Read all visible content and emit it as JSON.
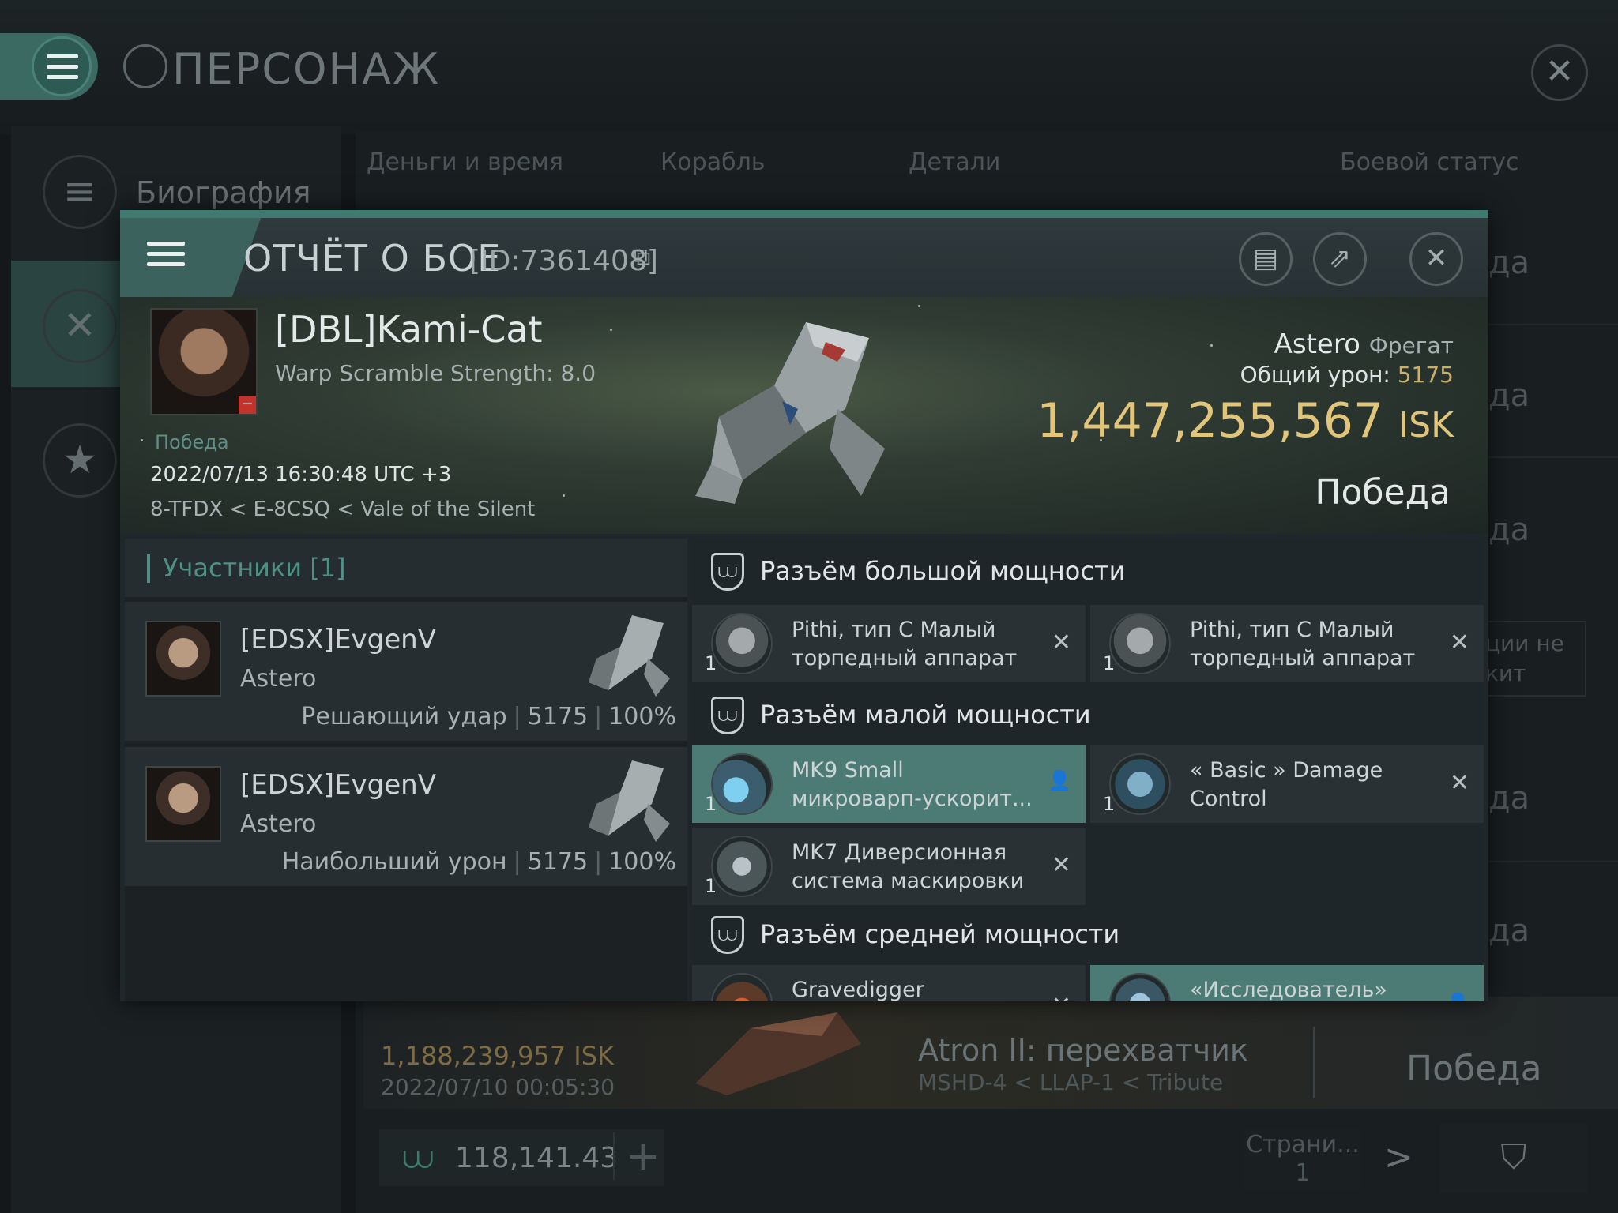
{
  "background": {
    "title": "ПЕРСОНАЖ",
    "sidebar_first_label": "Биография",
    "tabs": [
      "Деньги и время",
      "Корабль",
      "Детали",
      "Боевой статус"
    ],
    "right_column": [
      "да",
      "да",
      "да",
      "да",
      "да"
    ],
    "right_note": "ции не\nкит",
    "bottom_kill": {
      "isk": "1,188,239,957 ISK",
      "date": "2022/07/10 00:05:30",
      "ship": "Atron II: перехватчик",
      "location": "MSHD-4 < LLAP-1 < Tribute",
      "result": "Победа"
    },
    "footer_value": "118,141.43",
    "page_label": "Страни...",
    "page_number": "1"
  },
  "modal": {
    "title": "ОТЧЁТ О БОЕ",
    "id_label": "[ID:7361408]",
    "banner": {
      "pilot": "[DBL]Kami-Cat",
      "warp": "Warp Scramble Strength: 8.0",
      "win_small": "Победа",
      "datetime": "2022/07/13 16:30:48 UTC +3",
      "location": "8-TFDX < E-8CSQ < Vale of the Silent",
      "ship_name": "Astero",
      "ship_class": "Фрегат",
      "damage_label": "Общий урон:",
      "damage_value": "5175",
      "isk_value": "1,447,255,567",
      "isk_unit": "ISK",
      "result": "Победа"
    },
    "participants": {
      "label": "Участники [1]",
      "rows": [
        {
          "name": "[EDSX]EvgenV",
          "ship": "Astero",
          "role": "Решающий удар",
          "damage": "5175",
          "percent": "100%"
        },
        {
          "name": "[EDSX]EvgenV",
          "ship": "Astero",
          "role": "Наибольший урон",
          "damage": "5175",
          "percent": "100%"
        }
      ]
    },
    "slots": {
      "high": "Разъём большой мощности",
      "low": "Разъём малой мощности",
      "mid": "Разъём средней мощности"
    },
    "modules": {
      "high1": {
        "name": "Pithi, тип C Малый\nторпедный аппарат",
        "qty": "1",
        "status": "✕"
      },
      "high2": {
        "name": "Pithi, тип C Малый\nторпедный аппарат",
        "qty": "1",
        "status": "✕"
      },
      "low1": {
        "name": "MK9 Small\nмикроварп-ускорит...",
        "qty": "1",
        "status": "👤"
      },
      "low2": {
        "name": "« Basic » Damage\nControl",
        "qty": "1",
        "status": "✕"
      },
      "low3": {
        "name": "MK7 Диверсионная\nсистема маскировки",
        "qty": "1",
        "status": "✕"
      },
      "mid1": {
        "name": "Gravedigger",
        "qty": "",
        "status": "✕"
      },
      "mid2": {
        "name": "«Исследователь»",
        "qty": "",
        "status": "👤"
      }
    }
  }
}
